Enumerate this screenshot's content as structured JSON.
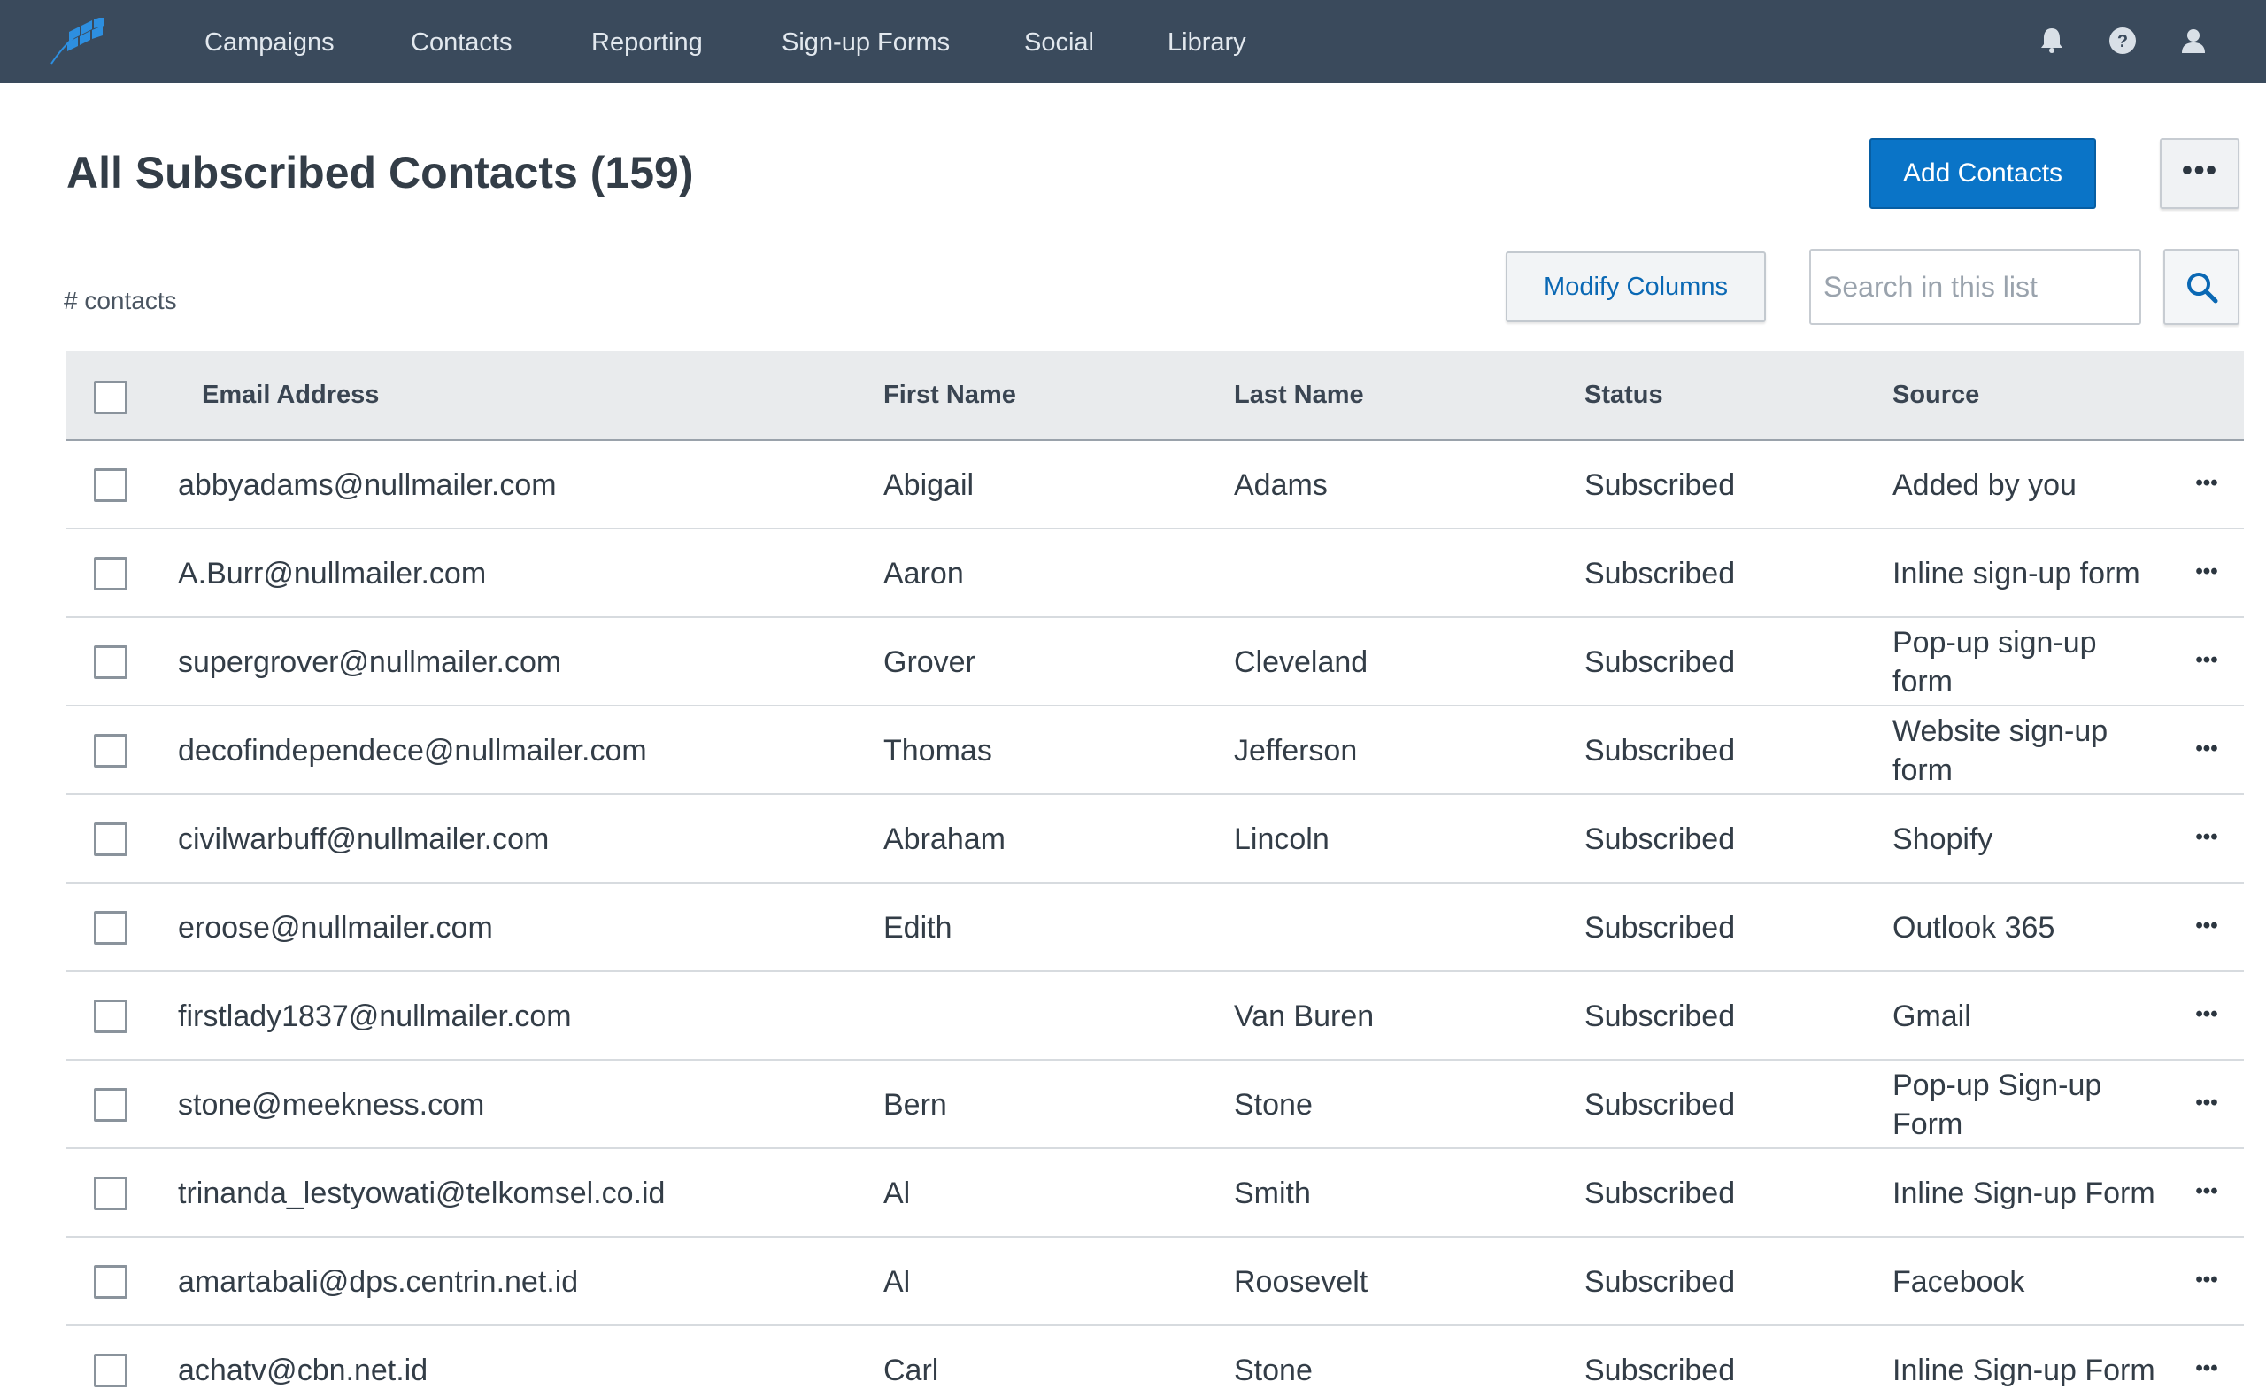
{
  "nav": {
    "items": [
      {
        "label": "Campaigns"
      },
      {
        "label": "Contacts"
      },
      {
        "label": "Reporting"
      },
      {
        "label": "Sign-up Forms"
      },
      {
        "label": "Social"
      },
      {
        "label": "Library"
      }
    ],
    "icons": [
      "bell-icon",
      "help-icon",
      "user-icon"
    ]
  },
  "header": {
    "title": "All Subscribed Contacts (159)",
    "add_button": "Add Contacts",
    "more_button": "•••"
  },
  "toolbar": {
    "count_label": "# contacts",
    "modify_columns": "Modify Columns",
    "search_placeholder": "Search in this list"
  },
  "table": {
    "columns": [
      "Email Address",
      "First Name",
      "Last Name",
      "Status",
      "Source"
    ],
    "rows": [
      {
        "email": "abbyadams@nullmailer.com",
        "first": "Abigail",
        "last": "Adams",
        "status": "Subscribed",
        "source": "Added by you"
      },
      {
        "email": "A.Burr@nullmailer.com",
        "first": "Aaron",
        "last": "",
        "status": "Subscribed",
        "source": "Inline sign-up form"
      },
      {
        "email": "supergrover@nullmailer.com",
        "first": "Grover",
        "last": "Cleveland",
        "status": "Subscribed",
        "source": "Pop-up sign-up form"
      },
      {
        "email": "decofindependece@nullmailer.com",
        "first": "Thomas",
        "last": "Jefferson",
        "status": "Subscribed",
        "source": "Website sign-up form"
      },
      {
        "email": "civilwarbuff@nullmailer.com",
        "first": "Abraham",
        "last": "Lincoln",
        "status": "Subscribed",
        "source": "Shopify"
      },
      {
        "email": "eroose@nullmailer.com",
        "first": "Edith",
        "last": "",
        "status": "Subscribed",
        "source": "Outlook 365"
      },
      {
        "email": "firstlady1837@nullmailer.com",
        "first": "",
        "last": "Van Buren",
        "status": "Subscribed",
        "source": "Gmail"
      },
      {
        "email": "stone@meekness.com",
        "first": "Bern",
        "last": "Stone",
        "status": "Subscribed",
        "source": "Pop-up Sign-up Form"
      },
      {
        "email": "trinanda_lestyowati@telkomsel.co.id",
        "first": "Al",
        "last": "Smith",
        "status": "Subscribed",
        "source": "Inline Sign-up Form"
      },
      {
        "email": "amartabali@dps.centrin.net.id",
        "first": "Al",
        "last": "Roosevelt",
        "status": "Subscribed",
        "source": "Facebook"
      },
      {
        "email": "achatv@cbn.net.id",
        "first": "Carl",
        "last": "Stone",
        "status": "Subscribed",
        "source": "Inline Sign-up Form"
      }
    ],
    "row_more": "•••"
  },
  "colors": {
    "nav_bg": "#3a4a5c",
    "primary": "#0a74c7",
    "link": "#0a68b4",
    "table_header_bg": "#e9ebed"
  }
}
